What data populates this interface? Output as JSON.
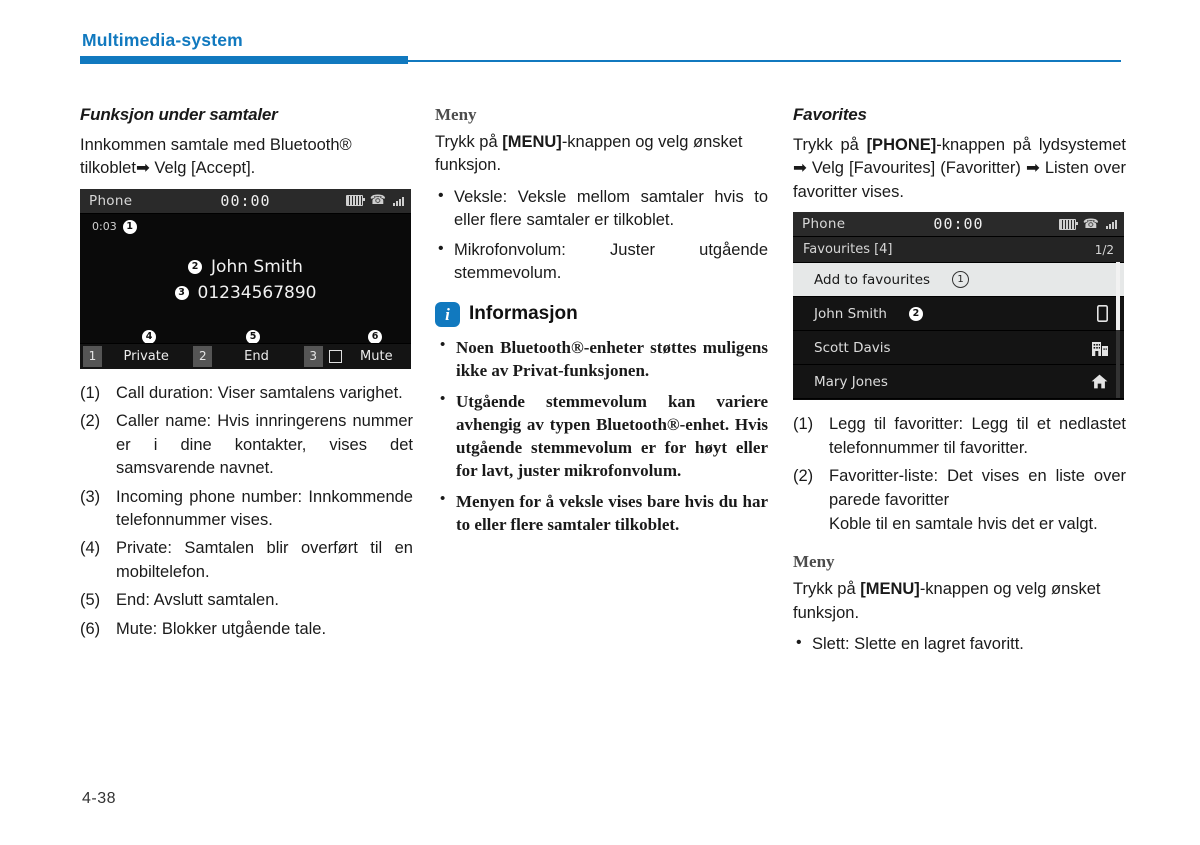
{
  "header": {
    "title": "Multimedia-system",
    "accent_color": "#1179bf"
  },
  "footer": {
    "page_number": "4-38"
  },
  "column1": {
    "section_title": "Funksjon under samtaler",
    "intro": "Innkommen samtale med Bluetooth® tilkoblet➡ Velg [Accept].",
    "call_screen": {
      "topbar": {
        "title": "Phone",
        "clock": "00:00",
        "icons": [
          "battery-icon",
          "bluetooth-phone-icon",
          "signal-icon"
        ]
      },
      "duration": "0:03",
      "duration_badge": "1",
      "caller_name": "John Smith",
      "caller_name_badge": "2",
      "phone_number": "01234567890",
      "phone_number_badge": "3",
      "softkeys": [
        {
          "num": "1",
          "label": "Private",
          "badge": "4",
          "checkbox": false
        },
        {
          "num": "2",
          "label": "End",
          "badge": "5",
          "checkbox": false
        },
        {
          "num": "3",
          "label": "Mute",
          "badge": "6",
          "checkbox": true
        }
      ]
    },
    "list": [
      {
        "label": "(1)",
        "text": "Call duration: Viser samtalens varighet."
      },
      {
        "label": "(2)",
        "text": "Caller name: Hvis innringerens nummer er i dine kontakter, vises det samsvarende navnet."
      },
      {
        "label": "(3)",
        "text": "Incoming phone number: Innkommende telefonnummer vises."
      },
      {
        "label": "(4)",
        "text": "Private: Samtalen blir overført til en mobiltelefon."
      },
      {
        "label": "(5)",
        "text": "End: Avslutt samtalen."
      },
      {
        "label": "(6)",
        "text": "Mute: Blokker utgående tale."
      }
    ]
  },
  "column2": {
    "meny_title": "Meny",
    "meny_intro_pre": "Trykk på ",
    "meny_intro_bold": "[MENU]",
    "meny_intro_post": "-knappen og velg ønsket funksjon.",
    "meny_bullets": [
      "Veksle: Veksle mellom samtaler hvis to eller flere samtaler er tilkoblet.",
      "Mikrofonvolum: Juster utgående stemmevolum."
    ],
    "info_icon_glyph": "i",
    "info_title": "Informasjon",
    "info_bullets": [
      "Noen Bluetooth®-enheter støttes muligens ikke av Privat-funksjonen.",
      "Utgående stemmevolum kan variere avhengig av typen Bluetooth®-enhet. Hvis utgående stemmevolum er for høyt eller for lavt, juster mikrofonvolum.",
      "Menyen for å veksle vises bare hvis du har to eller flere samtaler tilkoblet."
    ]
  },
  "column3": {
    "section_title": "Favorites",
    "intro_pre": "Trykk på ",
    "intro_bold": "[PHONE]",
    "intro_post": "-knappen på lydsystemet ➡ Velg [Favourites] (Favoritter) ➡ Listen over favoritter vises.",
    "fav_screen": {
      "topbar": {
        "title": "Phone",
        "clock": "00:00",
        "icons": [
          "battery-icon",
          "bluetooth-phone-icon",
          "signal-icon"
        ]
      },
      "subbar_title": "Favourites [4]",
      "page_indicator": "1/2",
      "rows": [
        {
          "name": "Add to favourites",
          "badge": "1",
          "icon": "",
          "selected": true
        },
        {
          "name": "John Smith",
          "badge": "2",
          "icon": "mobile-phone-icon",
          "selected": false
        },
        {
          "name": "Scott Davis",
          "badge": "",
          "icon": "office-building-icon",
          "selected": false
        },
        {
          "name": "Mary Jones",
          "badge": "",
          "icon": "home-icon",
          "selected": false
        }
      ]
    },
    "list": [
      {
        "label": "(1)",
        "text": "Legg til favoritter: Legg til et nedlastet telefonnummer til favoritter.",
        "sub": ""
      },
      {
        "label": "(2)",
        "text": "Favoritter-liste: Det vises en liste over parede favoritter",
        "sub": "Koble til en samtale hvis det er valgt."
      }
    ],
    "meny_title": "Meny",
    "meny_intro_pre": "Trykk på ",
    "meny_intro_bold": "[MENU]",
    "meny_intro_post": "-knappen og velg ønsket funksjon.",
    "meny_bullets": [
      "Slett: Slette en lagret favoritt."
    ]
  }
}
